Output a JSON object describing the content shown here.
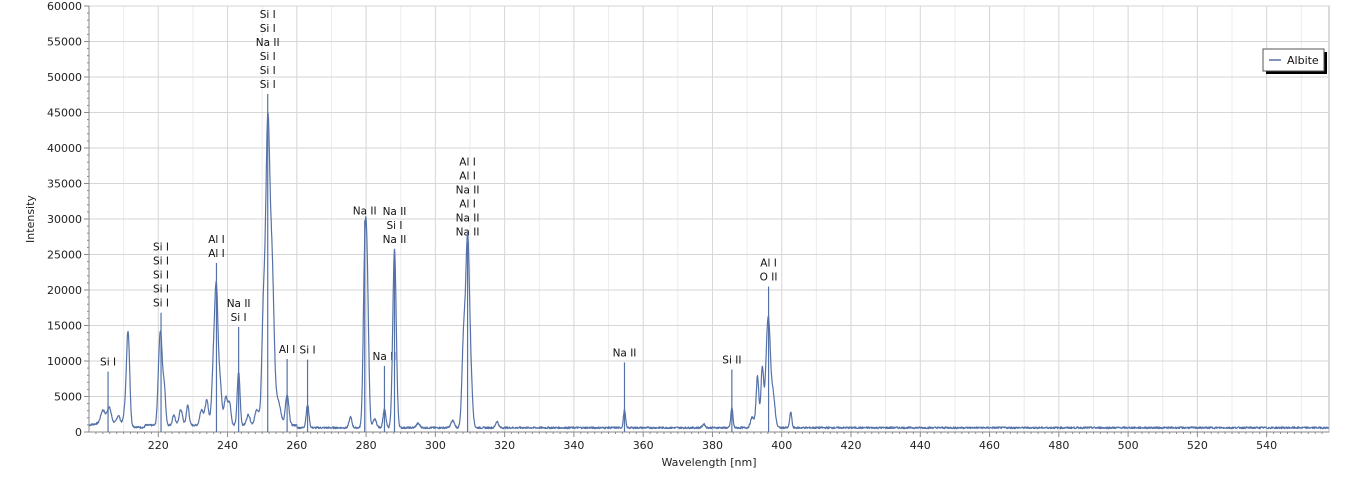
{
  "chart_data": {
    "type": "line",
    "title": "",
    "xlabel": "Wavelength [nm]",
    "ylabel": "Intensity",
    "xlim": [
      200,
      558
    ],
    "ylim": [
      0,
      60000
    ],
    "x_ticks": [
      220,
      240,
      260,
      280,
      300,
      320,
      340,
      360,
      380,
      400,
      420,
      440,
      460,
      480,
      500,
      520,
      540
    ],
    "y_ticks": [
      0,
      5000,
      10000,
      15000,
      20000,
      25000,
      30000,
      35000,
      40000,
      45000,
      50000,
      55000,
      60000
    ],
    "grid": true,
    "legend_position": "top-right",
    "series": [
      {
        "name": "Albite",
        "color": "#5572a8",
        "baseline": 600,
        "peaks": [
          {
            "x": 204,
            "y": 1800,
            "w": 0.6
          },
          {
            "x": 205.8,
            "y": 2200,
            "w": 0.6
          },
          {
            "x": 208.5,
            "y": 1200,
            "w": 0.5
          },
          {
            "x": 210.5,
            "y": 2200,
            "w": 0.5
          },
          {
            "x": 211.3,
            "y": 12800,
            "w": 0.45
          },
          {
            "x": 220.2,
            "y": 7000,
            "w": 0.4
          },
          {
            "x": 220.8,
            "y": 10200,
            "w": 0.4
          },
          {
            "x": 221.7,
            "y": 5500,
            "w": 0.4
          },
          {
            "x": 224.5,
            "y": 1500,
            "w": 0.4
          },
          {
            "x": 226.5,
            "y": 2200,
            "w": 0.5
          },
          {
            "x": 228.5,
            "y": 2800,
            "w": 0.4
          },
          {
            "x": 232.5,
            "y": 2200,
            "w": 0.5
          },
          {
            "x": 234.0,
            "y": 3500,
            "w": 0.5
          },
          {
            "x": 236.0,
            "y": 9000,
            "w": 0.5
          },
          {
            "x": 236.8,
            "y": 16800,
            "w": 0.45
          },
          {
            "x": 237.8,
            "y": 6000,
            "w": 0.5
          },
          {
            "x": 239.5,
            "y": 4000,
            "w": 0.5
          },
          {
            "x": 240.6,
            "y": 3000,
            "w": 0.4
          },
          {
            "x": 243.2,
            "y": 7500,
            "w": 0.4
          },
          {
            "x": 246.0,
            "y": 1500,
            "w": 0.5
          },
          {
            "x": 248.5,
            "y": 2200,
            "w": 0.6
          },
          {
            "x": 250.4,
            "y": 16000,
            "w": 0.5
          },
          {
            "x": 251.6,
            "y": 40000,
            "w": 0.55
          },
          {
            "x": 252.8,
            "y": 22000,
            "w": 0.6
          },
          {
            "x": 254.5,
            "y": 3500,
            "w": 0.8
          },
          {
            "x": 257.2,
            "y": 4200,
            "w": 0.5
          },
          {
            "x": 263.1,
            "y": 3200,
            "w": 0.4
          },
          {
            "x": 275.5,
            "y": 1500,
            "w": 0.4
          },
          {
            "x": 279.6,
            "y": 21000,
            "w": 0.45
          },
          {
            "x": 280.3,
            "y": 19000,
            "w": 0.45
          },
          {
            "x": 282.5,
            "y": 1200,
            "w": 0.5
          },
          {
            "x": 285.3,
            "y": 2600,
            "w": 0.4
          },
          {
            "x": 288.2,
            "y": 25000,
            "w": 0.5
          },
          {
            "x": 295.0,
            "y": 600,
            "w": 0.5
          },
          {
            "x": 305.0,
            "y": 1000,
            "w": 0.5
          },
          {
            "x": 308.2,
            "y": 12800,
            "w": 0.5
          },
          {
            "x": 309.3,
            "y": 25000,
            "w": 0.5
          },
          {
            "x": 310.2,
            "y": 7000,
            "w": 0.5
          },
          {
            "x": 317.8,
            "y": 900,
            "w": 0.4
          },
          {
            "x": 354.6,
            "y": 2500,
            "w": 0.3
          },
          {
            "x": 377.5,
            "y": 500,
            "w": 0.4
          },
          {
            "x": 385.6,
            "y": 2800,
            "w": 0.3
          },
          {
            "x": 391.5,
            "y": 1500,
            "w": 0.5
          },
          {
            "x": 393.0,
            "y": 7200,
            "w": 0.4
          },
          {
            "x": 394.4,
            "y": 8500,
            "w": 0.4
          },
          {
            "x": 395.5,
            "y": 5000,
            "w": 0.4
          },
          {
            "x": 396.2,
            "y": 13800,
            "w": 0.5
          },
          {
            "x": 397.4,
            "y": 5000,
            "w": 0.6
          },
          {
            "x": 402.6,
            "y": 2200,
            "w": 0.3
          }
        ]
      }
    ],
    "annotations": [
      {
        "x": 205.5,
        "tip": 8500,
        "labels": [
          "Si I"
        ]
      },
      {
        "x": 220.8,
        "tip": 16800,
        "labels": [
          "Si I",
          "Si I",
          "Si I",
          "Si I",
          "Si I"
        ]
      },
      {
        "x": 236.8,
        "tip": 23800,
        "labels": [
          "Al I",
          "Al I"
        ]
      },
      {
        "x": 243.2,
        "tip": 14800,
        "labels": [
          "Na II",
          "Si I"
        ]
      },
      {
        "x": 251.6,
        "tip": 47600,
        "labels": [
          "Si I",
          "Si I",
          "Na II",
          "Si I",
          "Si I",
          "Si I"
        ]
      },
      {
        "x": 257.2,
        "tip": 10300,
        "labels": [
          "Al I"
        ]
      },
      {
        "x": 263.1,
        "tip": 10200,
        "labels": [
          "Si I"
        ]
      },
      {
        "x": 279.6,
        "tip": 29800,
        "labels": [
          "Na II"
        ]
      },
      {
        "x": 285.3,
        "tip": 9300,
        "labels": [
          "Na II"
        ]
      },
      {
        "x": 288.2,
        "tip": 25800,
        "labels": [
          "Na II",
          "Si I",
          "Na II"
        ]
      },
      {
        "x": 309.3,
        "tip": 26800,
        "labels": [
          "Al I",
          "Al I",
          "Na II",
          "Al I",
          "Na II",
          "Na II"
        ]
      },
      {
        "x": 354.6,
        "tip": 9800,
        "labels": [
          "Na II"
        ]
      },
      {
        "x": 385.6,
        "tip": 8800,
        "labels": [
          "Si II"
        ]
      },
      {
        "x": 396.2,
        "tip": 20500,
        "labels": [
          "Al I",
          "O II"
        ]
      }
    ]
  }
}
